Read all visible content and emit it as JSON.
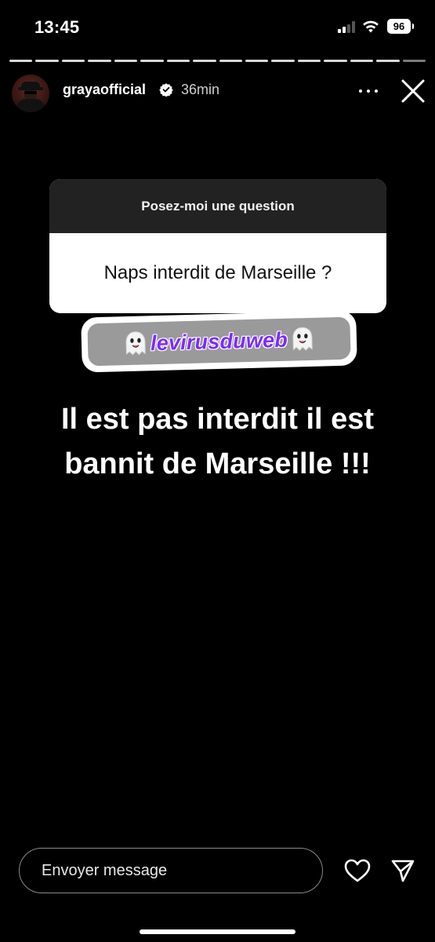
{
  "status_bar": {
    "time": "13:45",
    "battery": "96"
  },
  "story": {
    "segments": {
      "total": 16,
      "completed": 15
    },
    "username": "grayaofficial",
    "time_ago": "36min",
    "verified": true
  },
  "question": {
    "prompt": "Posez-moi une question",
    "answer": "Naps interdit de Marseille ?"
  },
  "mention": {
    "handle": "levirusduweb",
    "emoji": "ghost"
  },
  "caption": {
    "line1": "Il est pas interdit il est",
    "line2": "bannit de Marseille !!!"
  },
  "reply": {
    "placeholder": "Envoyer message"
  },
  "icons": {
    "more": "more-horizontal-icon",
    "close": "close-icon",
    "like": "heart-icon",
    "send": "send-icon"
  },
  "colors": {
    "mention": "#7b2cff",
    "background": "#000000"
  }
}
